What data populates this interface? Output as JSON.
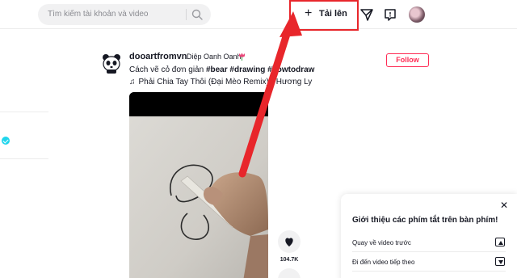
{
  "header": {
    "search": {
      "placeholder": "Tìm kiếm tài khoản và video"
    },
    "upload": {
      "label": "Tải lên"
    }
  },
  "post": {
    "username": "dooartfromvn",
    "nickname": "Diệp Oanh Oanh",
    "caption_text": "Cách vẽ cỏ đơn giản",
    "hashtags": [
      "#bear",
      "#drawing",
      "#howtodraw"
    ],
    "music": "Phải Chia Tay Thôi (Đại Mèo Remix) - Hương Ly",
    "follow_label": "Follow",
    "like_count": "104.7K"
  },
  "shortcuts_panel": {
    "title": "Giới thiệu các phím tắt trên bàn phím!",
    "items": [
      {
        "label": "Quay về video trước",
        "key": "up-arrow-key-icon"
      },
      {
        "label": "Đi đến video tiếp theo",
        "key": "down-arrow-key-icon"
      }
    ]
  },
  "colors": {
    "accent": "#fe2c55",
    "annotation": "#e8262b"
  }
}
